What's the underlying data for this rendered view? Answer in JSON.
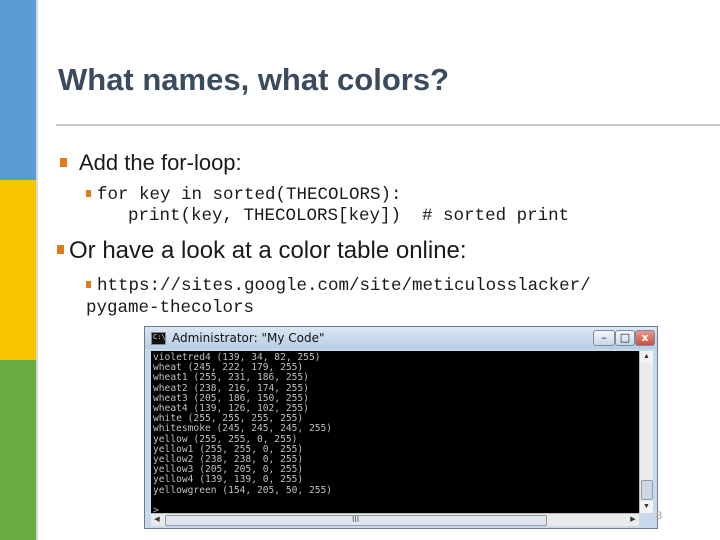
{
  "colors": {
    "sidebar_blue": "#5b9bd5",
    "sidebar_yellow": "#f9c400",
    "sidebar_green": "#6aab3f",
    "bullet": "#e07b1a",
    "title": "#3b4b5e"
  },
  "slide": {
    "title": "What names, what colors?",
    "bullet1": "Add the for-loop:",
    "code_lines": [
      "for key in sorted(THECOLORS):",
      "    print(key, THECOLORS[key])  # sorted print"
    ],
    "bullet2": "Or have a look at a color table online:",
    "url_lines": [
      "https://sites.google.com/site/meticulosslacker/",
      "pygame-thecolors"
    ],
    "page_number": "8"
  },
  "console_window": {
    "title": "Administrator: \"My Code\"",
    "app_icon": "cmd-icon",
    "icon_text": "C:\\",
    "buttons": {
      "minimize": "–",
      "maximize": "□",
      "close": "x"
    },
    "lines": [
      "violetred4 (139, 34, 82, 255)",
      "wheat (245, 222, 179, 255)",
      "wheat1 (255, 231, 186, 255)",
      "wheat2 (238, 216, 174, 255)",
      "wheat3 (205, 186, 150, 255)",
      "wheat4 (139, 126, 102, 255)",
      "white (255, 255, 255, 255)",
      "whitesmoke (245, 245, 245, 255)",
      "yellow (255, 255, 0, 255)",
      "yellow1 (255, 255, 0, 255)",
      "yellow2 (238, 238, 0, 255)",
      "yellow3 (205, 205, 0, 255)",
      "yellow4 (139, 139, 0, 255)",
      "yellowgreen (154, 205, 50, 255)",
      "",
      ">"
    ],
    "scroll_up": "▲",
    "scroll_down": "▼",
    "scroll_left": "◀",
    "scroll_right": "▶",
    "hscroll_grip": "III"
  }
}
